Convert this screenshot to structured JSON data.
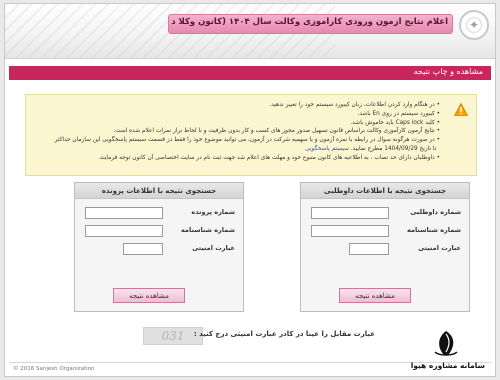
{
  "header": {
    "title": "اعلام نتایج آزمون ورودی کارآموزی وکالت سال ۱۴۰۴ (کانون وکلا دادگستری)",
    "logo_icon": "emblem-icon"
  },
  "nav": {
    "label": "مشاهده و چاپ نتیجه"
  },
  "notice": {
    "icon": "warning-icon",
    "lines": [
      "در هنگام وارد کردن اطلاعات، زبان کیبورد سیستم خود را تغییر ندهید.",
      "کیبورد سیستم در روی En باشد.",
      "کلید Caps lock باید خاموش باشد.",
      "نتایج آزمون کارآموزی وکالت براساس قانون تسهیل صدور مجوز های کسب و کار بدون ظرفیت و با لحاظ نراز نمرات اعلام شده است.",
      "در صورت هرگونه سوال در رابطه با نمره آزمون و یا سهمیه شرکت در آزمون، می توانید موضوع خود را فقط در قسمت سیستم پاسخگویی این سازمان حداکثر",
      "تا تاریخ 1404/09/29 مطرح نمایید.",
      "داوطلبان دارای حد نصاب ، به اطلاعیه های کانون متبوع خود و مهلت های اعلام شد جهت ثبت نام در سایت اختصاصی آن کانون توجه فرمایند."
    ],
    "link_text": "سیستم پاسخگویی"
  },
  "panel_right": {
    "title": "جستجوی نتیجه با اطلاعات داوطلبی",
    "fields": [
      {
        "label": "شماره داوطلبی",
        "value": ""
      },
      {
        "label": "شماره شناسنامه",
        "value": ""
      },
      {
        "label": "عبارت امنیتی",
        "value": ""
      }
    ],
    "button": "مشاهده نتیجه"
  },
  "panel_left": {
    "title": "جستجوی نتیجه با اطلاعات پرونده",
    "fields": [
      {
        "label": "شماره پرونده",
        "value": ""
      },
      {
        "label": "شماره شناسنامه",
        "value": ""
      },
      {
        "label": "عبارت امنیتی",
        "value": ""
      }
    ],
    "button": "مشاهده نتیجه"
  },
  "captcha": {
    "label": "عبارت مقابل را عینا در کادر عبارت امنیتی درج کنید :",
    "code": "031"
  },
  "footer": {
    "copyright": "© 2016 Sanjesh Organization"
  },
  "watermark": {
    "text": "سامانه مشاوره هیوا"
  },
  "colors": {
    "accent": "#c9265e",
    "notice_bg": "#fbf6cf",
    "title_band": "#e58ab0"
  }
}
